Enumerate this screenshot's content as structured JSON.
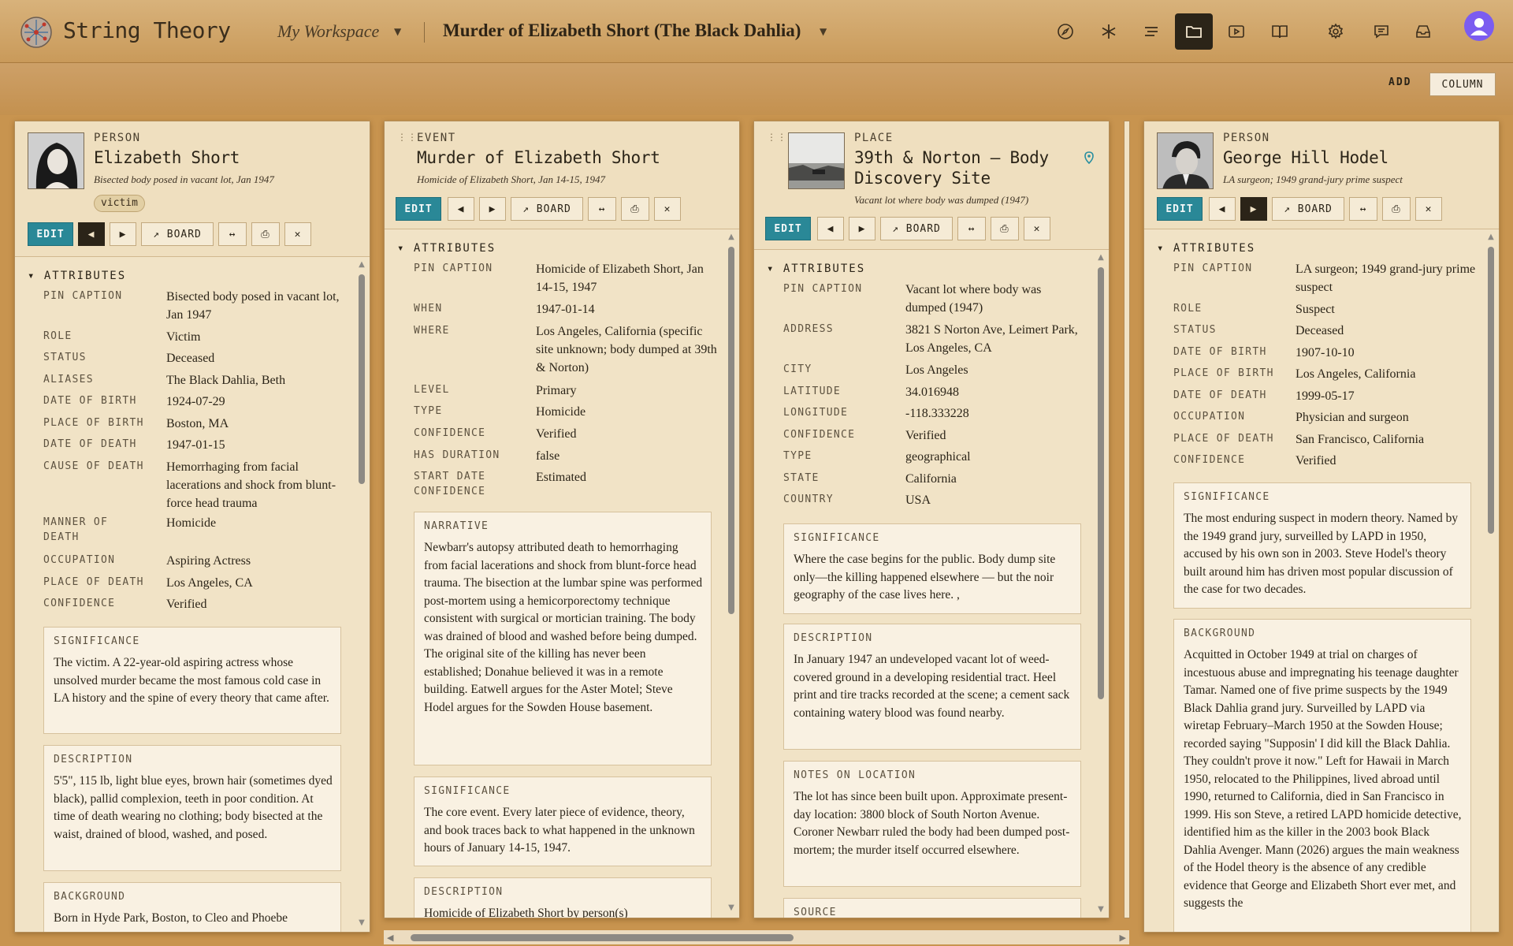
{
  "app": {
    "name": "String Theory",
    "workspace": "My Workspace",
    "board_title": "Murder of Elizabeth Short (The Black Dahlia)"
  },
  "toolbar": {
    "icons": [
      "compass-icon",
      "asterisk-icon",
      "list-icon",
      "folder-icon",
      "play-icon",
      "book-icon",
      "gear-icon",
      "chat-icon",
      "inbox-icon"
    ],
    "active": "folder-icon"
  },
  "subbar": {
    "add_label": "ADD",
    "column_label": "COLUMN"
  },
  "buttons": {
    "edit": "EDIT",
    "board": "BOARD"
  },
  "columns": [
    {
      "kind": "PERSON",
      "title": "Elizabeth Short",
      "caption": "Bisected body posed in vacant lot, Jan 1947",
      "tag": "victim",
      "section": "ATTRIBUTES",
      "attributes": [
        {
          "k": "PIN CAPTION",
          "v": "Bisected body posed in vacant lot, Jan 1947"
        },
        {
          "k": "ROLE",
          "v": "Victim"
        },
        {
          "k": "STATUS",
          "v": "Deceased"
        },
        {
          "k": "ALIASES",
          "v": "The Black Dahlia, Beth"
        },
        {
          "k": "DATE OF BIRTH",
          "v": "1924-07-29"
        },
        {
          "k": "PLACE OF BIRTH",
          "v": "Boston, MA"
        },
        {
          "k": "DATE OF DEATH",
          "v": "1947-01-15"
        },
        {
          "k": "CAUSE OF DEATH",
          "v": "Hemorrhaging from facial lacerations and shock from blunt-force head trauma"
        },
        {
          "k": "MANNER OF DEATH",
          "v": "Homicide"
        },
        {
          "k": "OCCUPATION",
          "v": "Aspiring Actress"
        },
        {
          "k": "PLACE OF DEATH",
          "v": "Los Angeles, CA"
        },
        {
          "k": "CONFIDENCE",
          "v": "Verified"
        }
      ],
      "boxes": [
        {
          "h": "SIGNIFICANCE",
          "t": "The victim. A 22-year-old aspiring actress whose unsolved murder became the most famous cold case in LA history and the spine of every theory that came after."
        },
        {
          "h": "DESCRIPTION",
          "t": "5'5\", 115 lb, light blue eyes, brown hair (sometimes dyed black), pallid complexion, teeth in poor condition. At time of death wearing no clothing; body bisected at the waist, drained of blood, washed, and posed."
        },
        {
          "h": "BACKGROUND",
          "t": "Born in Hyde Park, Boston, to Cleo and Phoebe"
        }
      ]
    },
    {
      "kind": "EVENT",
      "title": "Murder of Elizabeth Short",
      "caption": "Homicide of Elizabeth Short, Jan 14-15, 1947",
      "section": "ATTRIBUTES",
      "attributes": [
        {
          "k": "PIN CAPTION",
          "v": "Homicide of Elizabeth Short, Jan 14-15, 1947"
        },
        {
          "k": "WHEN",
          "v": "1947-01-14"
        },
        {
          "k": "WHERE",
          "v": "Los Angeles, California (specific site unknown; body dumped at 39th & Norton)"
        },
        {
          "k": "LEVEL",
          "v": "Primary"
        },
        {
          "k": "TYPE",
          "v": "Homicide"
        },
        {
          "k": "CONFIDENCE",
          "v": "Verified"
        },
        {
          "k": "HAS DURATION",
          "v": "false"
        },
        {
          "k": "START DATE CONFIDENCE",
          "v": "Estimated"
        }
      ],
      "boxes": [
        {
          "h": "NARRATIVE",
          "t": "Newbarr's autopsy attributed death to hemorrhaging from facial lacerations and shock from blunt-force head trauma. The bisection at the lumbar spine was performed post-mortem using a hemicorporectomy technique consistent with surgical or mortician training. The body was drained of blood and washed before being dumped. The original site of the killing has never been established; Donahue believed it was in a remote building. Eatwell argues for the Aster Motel; Steve Hodel argues for the Sowden House basement."
        },
        {
          "h": "SIGNIFICANCE",
          "t": "The core event. Every later piece of evidence, theory, and book traces back to what happened in the unknown hours of January 14-15, 1947."
        },
        {
          "h": "DESCRIPTION",
          "t": "Homicide of Elizabeth Short by person(s)"
        }
      ]
    },
    {
      "kind": "PLACE",
      "title": "39th & Norton — Body Discovery Site",
      "caption": "Vacant lot where body was dumped (1947)",
      "section": "ATTRIBUTES",
      "attributes": [
        {
          "k": "PIN CAPTION",
          "v": "Vacant lot where body was dumped (1947)"
        },
        {
          "k": "ADDRESS",
          "v": "3821 S Norton Ave, Leimert Park, Los Angeles, CA"
        },
        {
          "k": "CITY",
          "v": "Los Angeles"
        },
        {
          "k": "LATITUDE",
          "v": "34.016948"
        },
        {
          "k": "LONGITUDE",
          "v": "-118.333228"
        },
        {
          "k": "CONFIDENCE",
          "v": "Verified"
        },
        {
          "k": "TYPE",
          "v": "geographical"
        },
        {
          "k": "STATE",
          "v": "California"
        },
        {
          "k": "COUNTRY",
          "v": "USA"
        }
      ],
      "boxes": [
        {
          "h": "SIGNIFICANCE",
          "t": "Where the case begins for the public. Body dump site only—the killing happened elsewhere — but the noir geography of the case lives here. ,"
        },
        {
          "h": "DESCRIPTION",
          "t": "In January 1947 an undeveloped vacant lot of weed-covered ground in a developing residential tract. Heel print and tire tracks recorded at the scene; a cement sack containing watery blood was found nearby."
        },
        {
          "h": "NOTES ON LOCATION",
          "t": "The lot has since been built upon. Approximate present-day location: 3800 block of South Norton Avenue. Coroner Newbarr ruled the body had been dumped post-mortem; the murder itself occurred elsewhere."
        },
        {
          "h": "SOURCE",
          "t": ""
        }
      ]
    },
    {
      "kind": "PERSON",
      "title": "George Hill Hodel",
      "caption": "LA surgeon; 1949 grand-jury prime suspect",
      "section": "ATTRIBUTES",
      "attributes": [
        {
          "k": "PIN CAPTION",
          "v": "LA surgeon; 1949 grand-jury prime suspect"
        },
        {
          "k": "ROLE",
          "v": "Suspect"
        },
        {
          "k": "STATUS",
          "v": "Deceased"
        },
        {
          "k": "DATE OF BIRTH",
          "v": "1907-10-10"
        },
        {
          "k": "PLACE OF BIRTH",
          "v": "Los Angeles, California"
        },
        {
          "k": "DATE OF DEATH",
          "v": "1999-05-17"
        },
        {
          "k": "OCCUPATION",
          "v": "Physician and surgeon"
        },
        {
          "k": "PLACE OF DEATH",
          "v": "San Francisco, California"
        },
        {
          "k": "CONFIDENCE",
          "v": "Verified"
        }
      ],
      "boxes": [
        {
          "h": "SIGNIFICANCE",
          "t": "The most enduring suspect in modern theory. Named by the 1949 grand jury, surveilled by LAPD in 1950, accused by his own son in 2003. Steve Hodel's theory built around him has driven most popular discussion of the case for two decades."
        },
        {
          "h": "BACKGROUND",
          "t": "Acquitted in October 1949 at trial on charges of incestuous abuse and impregnating his teenage daughter Tamar. Named one of five prime suspects by the 1949 Black Dahlia grand jury. Surveilled by LAPD via wiretap February–March 1950 at the Sowden House; recorded saying \"Supposin' I did kill the Black Dahlia. They couldn't prove it now.\" Left for Hawaii in March 1950, relocated to the Philippines, lived abroad until 1990, returned to California, died in San Francisco in 1999. His son Steve, a retired LAPD homicide detective, identified him as the killer in the 2003 book Black Dahlia Avenger. Mann (2026) argues the main weakness of the Hodel theory is the absence of any credible evidence that George and Elizabeth Short ever met, and suggests the"
        }
      ]
    }
  ]
}
